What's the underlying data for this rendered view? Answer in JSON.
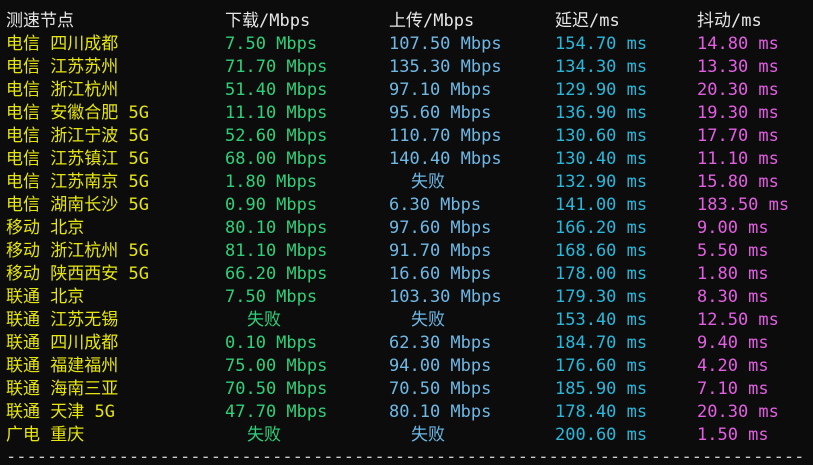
{
  "header": {
    "node": "测速节点",
    "download": "下载/Mbps",
    "upload": "上传/Mbps",
    "latency": "延迟/ms",
    "jitter": "抖动/ms"
  },
  "rows": [
    {
      "node": "电信 四川成都",
      "download": "7.50 Mbps",
      "upload": "107.50 Mbps",
      "latency": "154.70 ms",
      "jitter": "14.80 ms"
    },
    {
      "node": "电信 江苏苏州",
      "download": "71.70 Mbps",
      "upload": "135.30 Mbps",
      "latency": "134.30 ms",
      "jitter": "13.30 ms"
    },
    {
      "node": "电信 浙江杭州",
      "download": "51.40 Mbps",
      "upload": "97.10 Mbps",
      "latency": "129.90 ms",
      "jitter": "20.30 ms"
    },
    {
      "node": "电信 安徽合肥 5G",
      "download": "11.10 Mbps",
      "upload": "95.60 Mbps",
      "latency": "136.90 ms",
      "jitter": "19.30 ms"
    },
    {
      "node": "电信 浙江宁波 5G",
      "download": "52.60 Mbps",
      "upload": "110.70 Mbps",
      "latency": "130.60 ms",
      "jitter": "17.70 ms"
    },
    {
      "node": "电信 江苏镇江 5G",
      "download": "68.00 Mbps",
      "upload": "140.40 Mbps",
      "latency": "130.40 ms",
      "jitter": "11.10 ms"
    },
    {
      "node": "电信 江苏南京 5G",
      "download": "1.80 Mbps",
      "upload": "失败",
      "latency": "132.90 ms",
      "jitter": "15.80 ms"
    },
    {
      "node": "电信 湖南长沙 5G",
      "download": "0.90 Mbps",
      "upload": "6.30 Mbps",
      "latency": "141.00 ms",
      "jitter": "183.50 ms"
    },
    {
      "node": "移动 北京",
      "download": "80.10 Mbps",
      "upload": "97.60 Mbps",
      "latency": "166.20 ms",
      "jitter": "9.00 ms"
    },
    {
      "node": "移动 浙江杭州 5G",
      "download": "81.10 Mbps",
      "upload": "91.70 Mbps",
      "latency": "168.60 ms",
      "jitter": "5.50 ms"
    },
    {
      "node": "移动 陕西西安 5G",
      "download": "66.20 Mbps",
      "upload": "16.60 Mbps",
      "latency": "178.00 ms",
      "jitter": "1.80 ms"
    },
    {
      "node": "联通 北京",
      "download": "7.50 Mbps",
      "upload": "103.30 Mbps",
      "latency": "179.30 ms",
      "jitter": "8.30 ms"
    },
    {
      "node": "联通 江苏无锡",
      "download": "失败",
      "upload": "失败",
      "latency": "153.40 ms",
      "jitter": "12.50 ms"
    },
    {
      "node": "联通 四川成都",
      "download": "0.10 Mbps",
      "upload": "62.30 Mbps",
      "latency": "184.70 ms",
      "jitter": "9.40 ms"
    },
    {
      "node": "联通 福建福州",
      "download": "75.00 Mbps",
      "upload": "94.00 Mbps",
      "latency": "176.60 ms",
      "jitter": "4.20 ms"
    },
    {
      "node": "联通 海南三亚",
      "download": "70.50 Mbps",
      "upload": "70.50 Mbps",
      "latency": "185.90 ms",
      "jitter": "7.10 ms"
    },
    {
      "node": "联通 天津 5G",
      "download": "47.70 Mbps",
      "upload": "80.10 Mbps",
      "latency": "178.40 ms",
      "jitter": "20.30 ms"
    },
    {
      "node": "广电 重庆",
      "download": "失败",
      "upload": "失败",
      "latency": "200.60 ms",
      "jitter": "1.50 ms"
    }
  ],
  "divider": "--------------------------------------------------------------------------------------------------------------------------",
  "colors": {
    "background": "#0c0c0c",
    "node": "#e5e510",
    "download": "#2fd07a",
    "upload": "#6fb8e6",
    "latency": "#29b8db",
    "jitter": "#e35ee3"
  }
}
